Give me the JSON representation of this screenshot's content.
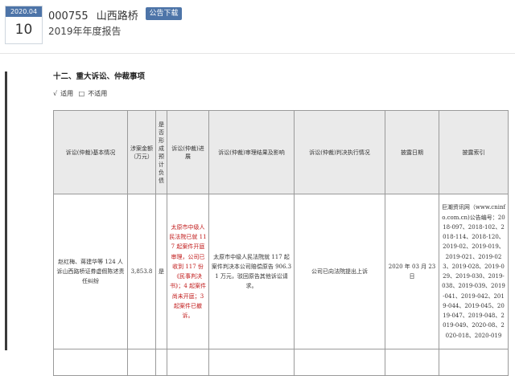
{
  "header": {
    "date_ym": "2020.04",
    "date_day": "10",
    "stock_code": "000755",
    "company": "山西路桥",
    "report_title": "2019年年度报告",
    "download_label": "公告下载"
  },
  "document": {
    "section_title": "十二、重大诉讼、仲裁事项",
    "applicable": {
      "checked_mark": "√",
      "yes_label": "适用",
      "unchecked_mark": "□",
      "no_label": "不适用"
    },
    "table": {
      "headers": [
        "诉讼(仲裁)基本情况",
        "涉案金额（万元）",
        "是否形成预计负债",
        "诉讼(仲裁)进展",
        "诉讼(仲裁)审理结果及影响",
        "诉讼(仲裁)判决执行情况",
        "披露日期",
        "披露索引"
      ],
      "rows": [
        {
          "basic": "赵红梅、蒋建华等 124 人诉山西路桥证券虚假陈述责任纠纷",
          "amount": "3,853.8",
          "liability": "是",
          "progress": "太原市中级人民法院已就 117 起案件开庭审理，公司已收到 117 份《民事判决书》；4 起案件尚未开庭；3 起案件已撤诉。",
          "result": "太原市中级人民法院就 117 起案件判决本公司赔偿原告 906.31 万元，驳回原告其他诉讼请求。",
          "execution": "公司已向法院提出上诉",
          "date": "2020 年 03 月 23 日",
          "index": "巨潮资讯网（www.cninfo.com.cn)公告编号：2018-097、2018-102、2018-114、2018-120、2019-02、2019-019、2019-021、2019-023、2019-028、2019-029、2019-030、2019-038、2019-039、2019-041、2019-042、2019-044、2019-045、2019-047、2019-048、2019-049、2020-08、2020-018、2020-019"
        }
      ]
    }
  }
}
